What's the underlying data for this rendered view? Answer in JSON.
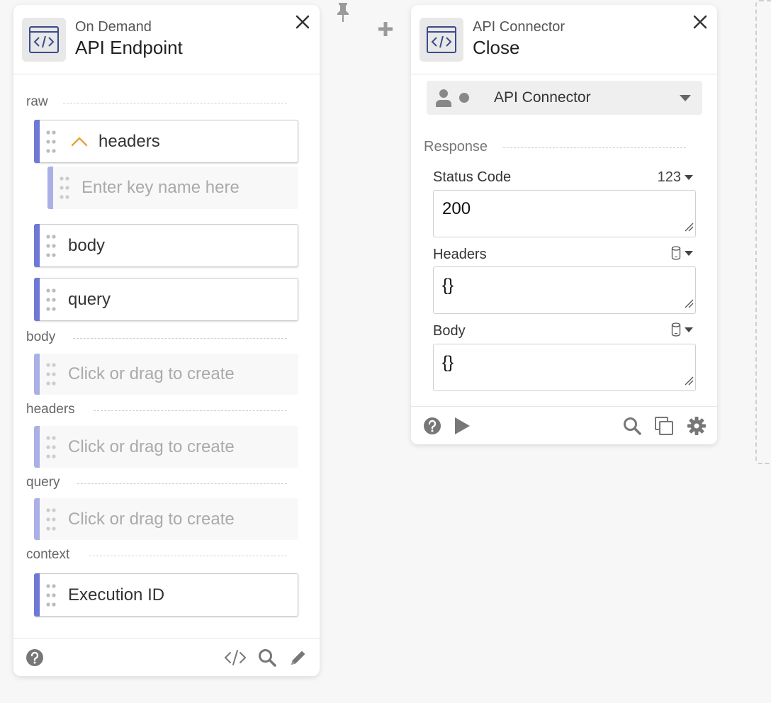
{
  "left_card": {
    "subtitle": "On Demand",
    "title": "API Endpoint",
    "sections": {
      "raw": "raw",
      "body": "body",
      "headers": "headers",
      "query": "query",
      "context": "context"
    },
    "raw_fields": {
      "headers": "headers",
      "key_placeholder": "Enter key name here",
      "body": "body",
      "query": "query"
    },
    "empty_placeholder": "Click or drag to create",
    "context_field": "Execution ID"
  },
  "right_card": {
    "subtitle": "API Connector",
    "title": "Close",
    "connector_select": "API Connector",
    "response_label": "Response",
    "params": {
      "status_code": {
        "label": "Status Code",
        "type_label": "123",
        "value": "200"
      },
      "headers": {
        "label": "Headers",
        "value": "{}"
      },
      "body": {
        "label": "Body",
        "value": "{}"
      }
    }
  },
  "icons": {
    "close": "close-icon",
    "code": "code-icon",
    "pin": "pin-icon",
    "plus": "plus-icon",
    "help": "help-icon",
    "play": "play-icon",
    "search": "search-icon",
    "copy": "copy-icon",
    "gear": "gear-icon",
    "pencil": "pencil-icon",
    "grip": "drag-handle-icon",
    "chevron_up": "chevron-up-icon",
    "database": "database-icon",
    "caret_down": "caret-down-icon",
    "user": "user-icon"
  },
  "colors": {
    "accent": "#6e78d6",
    "accent_light": "#aab0e6",
    "chevron": "#e8a33d",
    "icon_gray": "#777777"
  }
}
